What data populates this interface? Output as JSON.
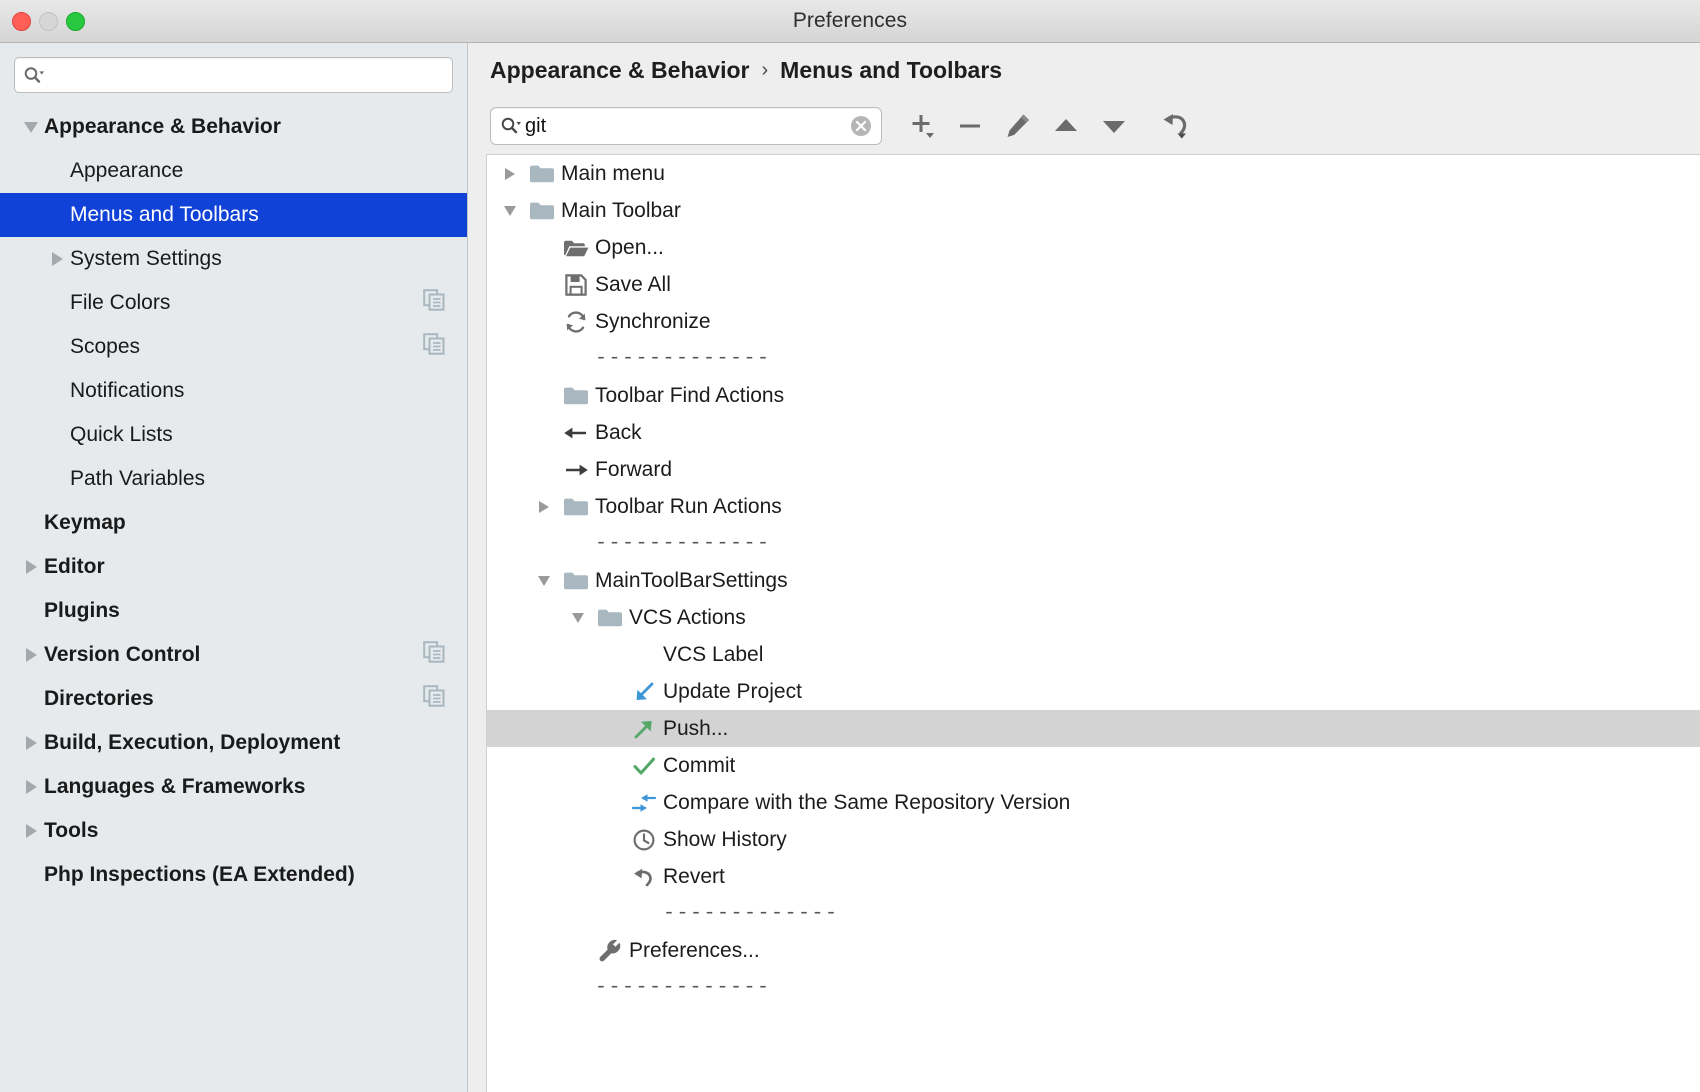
{
  "window": {
    "title": "Preferences",
    "traffic_lights": [
      "close-red",
      "minimize-yellow",
      "zoom-green"
    ]
  },
  "sidebar": {
    "search": {
      "value": "",
      "placeholder": ""
    },
    "items": [
      {
        "label": "Appearance & Behavior",
        "level": 0,
        "twisty": "down",
        "selected": false,
        "copy_badge": false
      },
      {
        "label": "Appearance",
        "level": 1,
        "twisty": "none",
        "selected": false,
        "copy_badge": false
      },
      {
        "label": "Menus and Toolbars",
        "level": 1,
        "twisty": "none",
        "selected": true,
        "copy_badge": false
      },
      {
        "label": "System Settings",
        "level": 1,
        "twisty": "right",
        "selected": false,
        "copy_badge": false
      },
      {
        "label": "File Colors",
        "level": 1,
        "twisty": "none",
        "selected": false,
        "copy_badge": true
      },
      {
        "label": "Scopes",
        "level": 1,
        "twisty": "none",
        "selected": false,
        "copy_badge": true
      },
      {
        "label": "Notifications",
        "level": 1,
        "twisty": "none",
        "selected": false,
        "copy_badge": false
      },
      {
        "label": "Quick Lists",
        "level": 1,
        "twisty": "none",
        "selected": false,
        "copy_badge": false
      },
      {
        "label": "Path Variables",
        "level": 1,
        "twisty": "none",
        "selected": false,
        "copy_badge": false
      },
      {
        "label": "Keymap",
        "level": 0,
        "twisty": "none",
        "selected": false,
        "copy_badge": false
      },
      {
        "label": "Editor",
        "level": 0,
        "twisty": "right",
        "selected": false,
        "copy_badge": false
      },
      {
        "label": "Plugins",
        "level": 0,
        "twisty": "none",
        "selected": false,
        "copy_badge": false
      },
      {
        "label": "Version Control",
        "level": 0,
        "twisty": "right",
        "selected": false,
        "copy_badge": true
      },
      {
        "label": "Directories",
        "level": 0,
        "twisty": "none",
        "selected": false,
        "copy_badge": true
      },
      {
        "label": "Build, Execution, Deployment",
        "level": 0,
        "twisty": "right",
        "selected": false,
        "copy_badge": false
      },
      {
        "label": "Languages & Frameworks",
        "level": 0,
        "twisty": "right",
        "selected": false,
        "copy_badge": false
      },
      {
        "label": "Tools",
        "level": 0,
        "twisty": "right",
        "selected": false,
        "copy_badge": false
      },
      {
        "label": "Php Inspections (EA Extended)",
        "level": 0,
        "twisty": "none",
        "selected": false,
        "copy_badge": false
      }
    ]
  },
  "main": {
    "breadcrumb": {
      "root": "Appearance & Behavior",
      "separator": "›",
      "current": "Menus and Toolbars"
    },
    "toolbar": {
      "find": {
        "value": "git",
        "placeholder": ""
      },
      "clear_icon": "clear-circle-icon",
      "buttons": [
        {
          "name": "add-button",
          "icon": "plus-with-dropdown-icon"
        },
        {
          "name": "remove-button",
          "icon": "minus-icon"
        },
        {
          "name": "edit-button",
          "icon": "pencil-icon"
        },
        {
          "name": "move-up-button",
          "icon": "triangle-up-icon"
        },
        {
          "name": "move-down-button",
          "icon": "triangle-down-icon"
        },
        {
          "name": "restore-button",
          "icon": "revert-arrow-with-dropdown-icon"
        }
      ]
    },
    "tree": [
      {
        "label": "Main menu",
        "depth": 0,
        "twisty": "right",
        "icon": "folder",
        "selected": false
      },
      {
        "label": "Main Toolbar",
        "depth": 0,
        "twisty": "down",
        "icon": "folder",
        "selected": false
      },
      {
        "label": "Open...",
        "depth": 1,
        "twisty": "none",
        "icon": "open-folder",
        "selected": false
      },
      {
        "label": "Save All",
        "depth": 1,
        "twisty": "none",
        "icon": "save",
        "selected": false
      },
      {
        "label": "Synchronize",
        "depth": 1,
        "twisty": "none",
        "icon": "sync",
        "selected": false
      },
      {
        "label": "-------------",
        "depth": 1,
        "twisty": "none",
        "icon": "none",
        "selected": false,
        "separator": true
      },
      {
        "label": "Toolbar Find Actions",
        "depth": 1,
        "twisty": "none",
        "icon": "folder",
        "selected": false
      },
      {
        "label": "Back",
        "depth": 1,
        "twisty": "none",
        "icon": "arrow-left",
        "selected": false
      },
      {
        "label": "Forward",
        "depth": 1,
        "twisty": "none",
        "icon": "arrow-right",
        "selected": false
      },
      {
        "label": "Toolbar Run Actions",
        "depth": 1,
        "twisty": "right",
        "icon": "folder",
        "selected": false
      },
      {
        "label": "-------------",
        "depth": 1,
        "twisty": "none",
        "icon": "none",
        "selected": false,
        "separator": true
      },
      {
        "label": "MainToolBarSettings",
        "depth": 1,
        "twisty": "down",
        "icon": "folder",
        "selected": false
      },
      {
        "label": "VCS Actions",
        "depth": 2,
        "twisty": "down",
        "icon": "folder",
        "selected": false
      },
      {
        "label": "VCS Label",
        "depth": 3,
        "twisty": "none",
        "icon": "none",
        "selected": false
      },
      {
        "label": "Update Project",
        "depth": 3,
        "twisty": "none",
        "icon": "update-project",
        "selected": false
      },
      {
        "label": "Push...",
        "depth": 3,
        "twisty": "none",
        "icon": "push",
        "selected": true
      },
      {
        "label": "Commit",
        "depth": 3,
        "twisty": "none",
        "icon": "commit-check",
        "selected": false
      },
      {
        "label": "Compare with the Same Repository Version",
        "depth": 3,
        "twisty": "none",
        "icon": "compare",
        "selected": false
      },
      {
        "label": "Show History",
        "depth": 3,
        "twisty": "none",
        "icon": "clock",
        "selected": false
      },
      {
        "label": "Revert",
        "depth": 3,
        "twisty": "none",
        "icon": "revert",
        "selected": false
      },
      {
        "label": "-------------",
        "depth": 3,
        "twisty": "none",
        "icon": "none",
        "selected": false,
        "separator": true
      },
      {
        "label": "Preferences...",
        "depth": 2,
        "twisty": "none",
        "icon": "wrench",
        "selected": false
      },
      {
        "label": "-------------",
        "depth": 1,
        "twisty": "none",
        "icon": "none",
        "selected": false,
        "separator": true
      }
    ]
  },
  "colors": {
    "selection_blue": "#1142d8",
    "row_selected_gray": "#d3d3d3",
    "sidebar_bg": "#e6eaed",
    "folder_gray": "#a9b7c0",
    "icon_blue": "#3d96d6",
    "icon_green": "#5cb85c",
    "icon_gray": "#6e6e6e"
  }
}
